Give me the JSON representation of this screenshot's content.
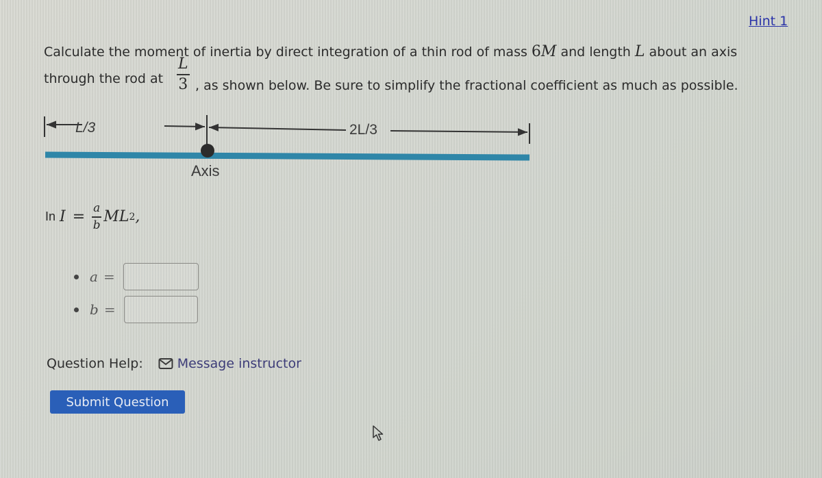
{
  "hint": {
    "label": "Hint 1"
  },
  "prompt": {
    "line1_prefix": "Calculate the moment of inertia by direct integration of a thin rod of mass ",
    "mass_coef": "6",
    "mass_var": "M",
    "line1_mid": " and length ",
    "length_var": "L",
    "line1_suffix": " about an axis",
    "line2_prefix": "through the rod at ",
    "axis_pos_num": "L",
    "axis_pos_den": "3",
    "line2_suffix": ", as shown below. Be sure to simplify the fractional coefficient as much as possible."
  },
  "diagram": {
    "left_segment_label": "L/3",
    "right_segment_label": "2L/3",
    "axis_label": "Axis",
    "rod_color": "#2f86a8",
    "line_color": "#333333"
  },
  "formula": {
    "prefix": "In",
    "lhs": "I",
    "equals": "=",
    "num": "a",
    "den": "b",
    "rhs": "ML",
    "exponent": "2",
    "trail": ","
  },
  "answers": [
    {
      "var": "a",
      "equals": "=",
      "value": ""
    },
    {
      "var": "b",
      "equals": "=",
      "value": ""
    }
  ],
  "help": {
    "label": "Question Help:",
    "message_link": "Message instructor"
  },
  "submit": {
    "label": "Submit Question"
  },
  "colors": {
    "link": "#2a33a8",
    "button_bg": "#2a5fb8",
    "rod": "#2f86a8"
  }
}
